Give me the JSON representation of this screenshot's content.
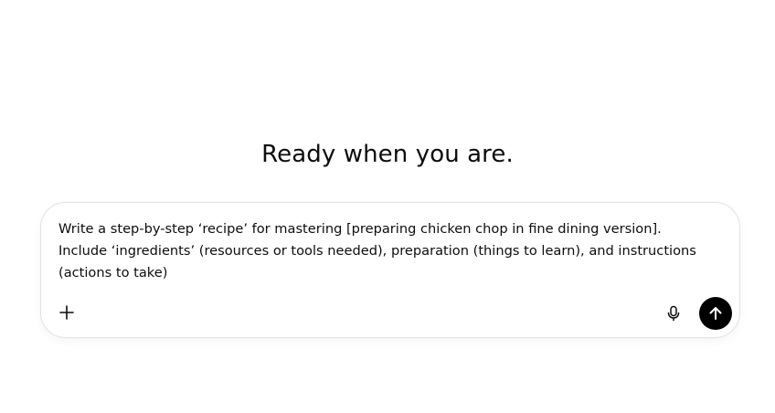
{
  "main": {
    "heading": "Ready when you are."
  },
  "composer": {
    "value": "Write a step-by-step ‘recipe’ for mastering [preparing chicken chop in fine dining version]. Include ‘ingredients’ (resources or tools needed), preparation (things to learn), and instructions (actions to take)"
  },
  "icons": {
    "add": "plus-icon",
    "mic": "microphone-icon",
    "send": "arrow-up-icon"
  },
  "colors": {
    "send_button_bg": "#000000",
    "composer_border": "#e3e3e3",
    "text": "#0d0d0d"
  }
}
